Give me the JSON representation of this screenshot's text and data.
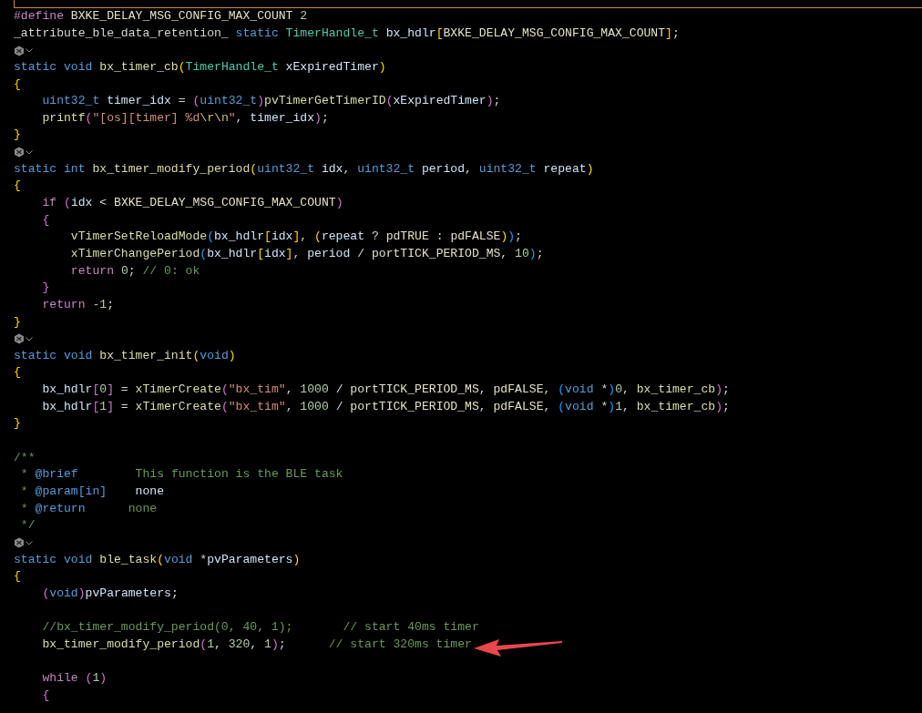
{
  "editor": {
    "lines": [
      {
        "kind": "code",
        "tokens": [
          {
            "t": "#define",
            "kind": "preproc"
          },
          {
            "t": " BXKE_DELAY_MSG_CONFIG_MAX_COUNT ",
            "kind": "macro"
          },
          {
            "t": "2",
            "kind": "number"
          }
        ]
      },
      {
        "kind": "code",
        "tokens": [
          {
            "t": "_attribute_ble_data_retention_ ",
            "kind": "plain"
          },
          {
            "t": "static ",
            "kind": "keyword"
          },
          {
            "t": "TimerHandle_t ",
            "kind": "type"
          },
          {
            "t": "bx_hdlr",
            "kind": "var"
          },
          {
            "t": "[",
            "kind": "b1"
          },
          {
            "t": "BXKE_DELAY_MSG_CONFIG_MAX_COUNT",
            "kind": "macro"
          },
          {
            "t": "]",
            "kind": "b1"
          },
          {
            "t": ";",
            "kind": "plain"
          }
        ]
      },
      {
        "kind": "icon"
      },
      {
        "kind": "code",
        "tokens": [
          {
            "t": "static void ",
            "kind": "keyword"
          },
          {
            "t": "bx_timer_cb",
            "kind": "func"
          },
          {
            "t": "(",
            "kind": "b1"
          },
          {
            "t": "TimerHandle_t ",
            "kind": "type"
          },
          {
            "t": "xExpiredTimer",
            "kind": "var"
          },
          {
            "t": ")",
            "kind": "b1"
          }
        ]
      },
      {
        "kind": "code",
        "tokens": [
          {
            "t": "{",
            "kind": "b1"
          }
        ]
      },
      {
        "kind": "code",
        "tokens": [
          {
            "t": "    uint32_t ",
            "kind": "keyword"
          },
          {
            "t": "timer_idx",
            "kind": "var"
          },
          {
            "t": " = ",
            "kind": "plain"
          },
          {
            "t": "(",
            "kind": "b2"
          },
          {
            "t": "uint32_t",
            "kind": "keyword"
          },
          {
            "t": ")",
            "kind": "b2"
          },
          {
            "t": "pvTimerGetTimerID",
            "kind": "func"
          },
          {
            "t": "(",
            "kind": "b2"
          },
          {
            "t": "xExpiredTimer",
            "kind": "var"
          },
          {
            "t": ")",
            "kind": "b2"
          },
          {
            "t": ";",
            "kind": "plain"
          }
        ]
      },
      {
        "kind": "code",
        "tokens": [
          {
            "t": "    printf",
            "kind": "func"
          },
          {
            "t": "(",
            "kind": "b2"
          },
          {
            "t": "\"[os][timer] %d",
            "kind": "string"
          },
          {
            "t": "\\r\\n",
            "kind": "escape"
          },
          {
            "t": "\"",
            "kind": "string"
          },
          {
            "t": ", ",
            "kind": "plain"
          },
          {
            "t": "timer_idx",
            "kind": "var"
          },
          {
            "t": ")",
            "kind": "b2"
          },
          {
            "t": ";",
            "kind": "plain"
          }
        ]
      },
      {
        "kind": "code",
        "tokens": [
          {
            "t": "}",
            "kind": "b1"
          }
        ]
      },
      {
        "kind": "icon"
      },
      {
        "kind": "code",
        "tokens": [
          {
            "t": "static int ",
            "kind": "keyword"
          },
          {
            "t": "bx_timer_modify_period",
            "kind": "func"
          },
          {
            "t": "(",
            "kind": "b1"
          },
          {
            "t": "uint32_t ",
            "kind": "keyword"
          },
          {
            "t": "idx",
            "kind": "var"
          },
          {
            "t": ", ",
            "kind": "plain"
          },
          {
            "t": "uint32_t ",
            "kind": "keyword"
          },
          {
            "t": "period",
            "kind": "var"
          },
          {
            "t": ", ",
            "kind": "plain"
          },
          {
            "t": "uint32_t ",
            "kind": "keyword"
          },
          {
            "t": "repeat",
            "kind": "var"
          },
          {
            "t": ")",
            "kind": "b1"
          }
        ]
      },
      {
        "kind": "code",
        "tokens": [
          {
            "t": "{",
            "kind": "b1"
          }
        ]
      },
      {
        "kind": "code",
        "tokens": [
          {
            "t": "    if ",
            "kind": "control"
          },
          {
            "t": "(",
            "kind": "b2"
          },
          {
            "t": "idx",
            "kind": "var"
          },
          {
            "t": " < ",
            "kind": "plain"
          },
          {
            "t": "BXKE_DELAY_MSG_CONFIG_MAX_COUNT",
            "kind": "macro"
          },
          {
            "t": ")",
            "kind": "b2"
          }
        ]
      },
      {
        "kind": "code",
        "tokens": [
          {
            "t": "    {",
            "kind": "b2"
          }
        ]
      },
      {
        "kind": "code",
        "tokens": [
          {
            "t": "        vTimerSetReloadMode",
            "kind": "func"
          },
          {
            "t": "(",
            "kind": "b3"
          },
          {
            "t": "bx_hdlr",
            "kind": "var"
          },
          {
            "t": "[",
            "kind": "b1"
          },
          {
            "t": "idx",
            "kind": "var"
          },
          {
            "t": "]",
            "kind": "b1"
          },
          {
            "t": ", ",
            "kind": "plain"
          },
          {
            "t": "(",
            "kind": "b1"
          },
          {
            "t": "repeat",
            "kind": "var"
          },
          {
            "t": " ? ",
            "kind": "plain"
          },
          {
            "t": "pdTRUE",
            "kind": "macro"
          },
          {
            "t": " : ",
            "kind": "plain"
          },
          {
            "t": "pdFALSE",
            "kind": "macro"
          },
          {
            "t": ")",
            "kind": "b1"
          },
          {
            "t": ")",
            "kind": "b3"
          },
          {
            "t": ";",
            "kind": "plain"
          }
        ]
      },
      {
        "kind": "code",
        "tokens": [
          {
            "t": "        xTimerChangePeriod",
            "kind": "func"
          },
          {
            "t": "(",
            "kind": "b3"
          },
          {
            "t": "bx_hdlr",
            "kind": "var"
          },
          {
            "t": "[",
            "kind": "b1"
          },
          {
            "t": "idx",
            "kind": "var"
          },
          {
            "t": "]",
            "kind": "b1"
          },
          {
            "t": ", ",
            "kind": "plain"
          },
          {
            "t": "period",
            "kind": "var"
          },
          {
            "t": " / ",
            "kind": "plain"
          },
          {
            "t": "portTICK_PERIOD_MS",
            "kind": "macro"
          },
          {
            "t": ", ",
            "kind": "plain"
          },
          {
            "t": "10",
            "kind": "number"
          },
          {
            "t": ")",
            "kind": "b3"
          },
          {
            "t": ";",
            "kind": "plain"
          }
        ]
      },
      {
        "kind": "code",
        "tokens": [
          {
            "t": "        return ",
            "kind": "control"
          },
          {
            "t": "0",
            "kind": "number"
          },
          {
            "t": "; ",
            "kind": "plain"
          },
          {
            "t": "// 0: ok",
            "kind": "comment"
          }
        ]
      },
      {
        "kind": "code",
        "tokens": [
          {
            "t": "    }",
            "kind": "b2"
          }
        ]
      },
      {
        "kind": "code",
        "tokens": [
          {
            "t": "    return ",
            "kind": "control"
          },
          {
            "t": "-1",
            "kind": "number"
          },
          {
            "t": ";",
            "kind": "plain"
          }
        ]
      },
      {
        "kind": "code",
        "tokens": [
          {
            "t": "}",
            "kind": "b1"
          }
        ]
      },
      {
        "kind": "icon"
      },
      {
        "kind": "code",
        "tokens": [
          {
            "t": "static void ",
            "kind": "keyword"
          },
          {
            "t": "bx_timer_init",
            "kind": "func"
          },
          {
            "t": "(",
            "kind": "b1"
          },
          {
            "t": "void",
            "kind": "keyword"
          },
          {
            "t": ")",
            "kind": "b1"
          }
        ]
      },
      {
        "kind": "code",
        "tokens": [
          {
            "t": "{",
            "kind": "b1"
          }
        ]
      },
      {
        "kind": "code",
        "tokens": [
          {
            "t": "    bx_hdlr",
            "kind": "var"
          },
          {
            "t": "[",
            "kind": "b2"
          },
          {
            "t": "0",
            "kind": "number"
          },
          {
            "t": "]",
            "kind": "b2"
          },
          {
            "t": " = ",
            "kind": "plain"
          },
          {
            "t": "xTimerCreate",
            "kind": "func"
          },
          {
            "t": "(",
            "kind": "b2"
          },
          {
            "t": "\"bx_tim\"",
            "kind": "string"
          },
          {
            "t": ", ",
            "kind": "plain"
          },
          {
            "t": "1000",
            "kind": "number"
          },
          {
            "t": " / ",
            "kind": "plain"
          },
          {
            "t": "portTICK_PERIOD_MS",
            "kind": "macro"
          },
          {
            "t": ", ",
            "kind": "plain"
          },
          {
            "t": "pdFALSE",
            "kind": "macro"
          },
          {
            "t": ", ",
            "kind": "plain"
          },
          {
            "t": "(",
            "kind": "b3"
          },
          {
            "t": "void ",
            "kind": "keyword"
          },
          {
            "t": "*",
            "kind": "plain"
          },
          {
            "t": ")",
            "kind": "b3"
          },
          {
            "t": "0",
            "kind": "number"
          },
          {
            "t": ", ",
            "kind": "plain"
          },
          {
            "t": "bx_timer_cb",
            "kind": "func"
          },
          {
            "t": ")",
            "kind": "b2"
          },
          {
            "t": ";",
            "kind": "plain"
          }
        ]
      },
      {
        "kind": "code",
        "tokens": [
          {
            "t": "    bx_hdlr",
            "kind": "var"
          },
          {
            "t": "[",
            "kind": "b2"
          },
          {
            "t": "1",
            "kind": "number"
          },
          {
            "t": "]",
            "kind": "b2"
          },
          {
            "t": " = ",
            "kind": "plain"
          },
          {
            "t": "xTimerCreate",
            "kind": "func"
          },
          {
            "t": "(",
            "kind": "b2"
          },
          {
            "t": "\"bx_tim\"",
            "kind": "string"
          },
          {
            "t": ", ",
            "kind": "plain"
          },
          {
            "t": "1000",
            "kind": "number"
          },
          {
            "t": " / ",
            "kind": "plain"
          },
          {
            "t": "portTICK_PERIOD_MS",
            "kind": "macro"
          },
          {
            "t": ", ",
            "kind": "plain"
          },
          {
            "t": "pdFALSE",
            "kind": "macro"
          },
          {
            "t": ", ",
            "kind": "plain"
          },
          {
            "t": "(",
            "kind": "b3"
          },
          {
            "t": "void ",
            "kind": "keyword"
          },
          {
            "t": "*",
            "kind": "plain"
          },
          {
            "t": ")",
            "kind": "b3"
          },
          {
            "t": "1",
            "kind": "number"
          },
          {
            "t": ", ",
            "kind": "plain"
          },
          {
            "t": "bx_timer_cb",
            "kind": "func"
          },
          {
            "t": ")",
            "kind": "b2"
          },
          {
            "t": ";",
            "kind": "plain"
          }
        ]
      },
      {
        "kind": "code",
        "tokens": [
          {
            "t": "}",
            "kind": "b1"
          }
        ]
      },
      {
        "kind": "blank"
      },
      {
        "kind": "code",
        "tokens": [
          {
            "t": "/**",
            "kind": "comment"
          }
        ]
      },
      {
        "kind": "code",
        "tokens": [
          {
            "t": " * ",
            "kind": "comment"
          },
          {
            "t": "@brief",
            "kind": "dockey"
          },
          {
            "t": "        This function is the BLE task",
            "kind": "comment"
          }
        ]
      },
      {
        "kind": "code",
        "tokens": [
          {
            "t": " * ",
            "kind": "comment"
          },
          {
            "t": "@param[in]",
            "kind": "dockey"
          },
          {
            "t": "    none",
            "kind": "var"
          }
        ]
      },
      {
        "kind": "code",
        "tokens": [
          {
            "t": " * ",
            "kind": "comment"
          },
          {
            "t": "@return",
            "kind": "dockey"
          },
          {
            "t": "      none",
            "kind": "comment"
          }
        ]
      },
      {
        "kind": "code",
        "tokens": [
          {
            "t": " */",
            "kind": "comment"
          }
        ]
      },
      {
        "kind": "icon"
      },
      {
        "kind": "code",
        "tokens": [
          {
            "t": "static void ",
            "kind": "keyword"
          },
          {
            "t": "ble_task",
            "kind": "func"
          },
          {
            "t": "(",
            "kind": "b1"
          },
          {
            "t": "void ",
            "kind": "keyword"
          },
          {
            "t": "*",
            "kind": "plain"
          },
          {
            "t": "pvParameters",
            "kind": "var"
          },
          {
            "t": ")",
            "kind": "b1"
          }
        ]
      },
      {
        "kind": "code",
        "tokens": [
          {
            "t": "{",
            "kind": "b1"
          }
        ]
      },
      {
        "kind": "code",
        "tokens": [
          {
            "t": "    (",
            "kind": "b2"
          },
          {
            "t": "void",
            "kind": "keyword"
          },
          {
            "t": ")",
            "kind": "b2"
          },
          {
            "t": "pvParameters",
            "kind": "var"
          },
          {
            "t": ";",
            "kind": "plain"
          }
        ]
      },
      {
        "kind": "blank"
      },
      {
        "kind": "code",
        "tokens": [
          {
            "t": "    //bx_timer_modify_period(0, 40, 1);       // start 40ms timer",
            "kind": "comment"
          }
        ]
      },
      {
        "kind": "code",
        "tokens": [
          {
            "t": "    bx_timer_modify_period",
            "kind": "func"
          },
          {
            "t": "(",
            "kind": "b2"
          },
          {
            "t": "1",
            "kind": "number"
          },
          {
            "t": ", ",
            "kind": "plain"
          },
          {
            "t": "320",
            "kind": "number"
          },
          {
            "t": ", ",
            "kind": "plain"
          },
          {
            "t": "1",
            "kind": "number"
          },
          {
            "t": ")",
            "kind": "b2"
          },
          {
            "t": ";",
            "kind": "plain"
          },
          {
            "t": "      // start 320ms timer",
            "kind": "comment"
          }
        ]
      },
      {
        "kind": "blank"
      },
      {
        "kind": "code",
        "tokens": [
          {
            "t": "    while ",
            "kind": "control"
          },
          {
            "t": "(",
            "kind": "b2"
          },
          {
            "t": "1",
            "kind": "number"
          },
          {
            "t": ")",
            "kind": "b2"
          }
        ]
      },
      {
        "kind": "code",
        "tokens": [
          {
            "t": "    {",
            "kind": "b2"
          }
        ]
      }
    ]
  }
}
